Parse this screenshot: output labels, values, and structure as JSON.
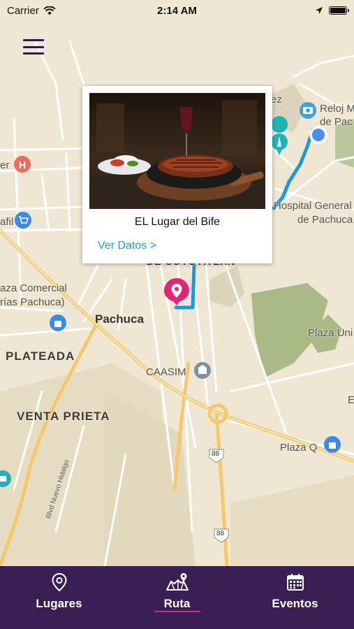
{
  "status_bar": {
    "carrier": "Carrier",
    "time": "2:14 AM",
    "battery_percent": 100
  },
  "map": {
    "labels": {
      "reloj": "Reloj M",
      "pac": "de Pac",
      "ez": "ez",
      "er": "er",
      "afil": "afil",
      "hospital1": "Hospital General",
      "hospital2": "de Pachuca",
      "coyotitlan": "DE COYOTITLAN",
      "plaza_comercial1": "aza Comercial",
      "plaza_comercial2": "rías Pachuca)",
      "pachuca": "Pachuca",
      "plateada": "PLATEADA",
      "caasim": "CAASIM",
      "venta_prieta": "VENTA PRIETA",
      "plaza_uni": "Plaza Uni",
      "plaza_q": "Plaza Q",
      "e": "E",
      "blvd": "Blvd Nuevo Hidalgo",
      "shield1": "88",
      "shield2": "88"
    }
  },
  "popup": {
    "title": "EL Lugar del Bife",
    "link": "Ver Datos >"
  },
  "tabs": [
    {
      "label": "Lugares",
      "icon": "location-pin-icon",
      "active": false
    },
    {
      "label": "Ruta",
      "icon": "map-route-icon",
      "active": true
    },
    {
      "label": "Eventos",
      "icon": "calendar-icon",
      "active": false
    }
  ],
  "colors": {
    "tab_bar": "#3a1f55",
    "active_underline": "#e0257a",
    "route": "#1a9ad6",
    "pin": "#e0257a",
    "link": "#1e9bd6"
  }
}
